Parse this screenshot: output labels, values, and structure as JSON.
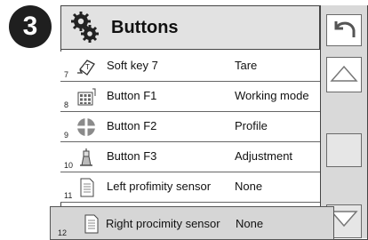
{
  "step_badge": "3",
  "header": {
    "title": "Buttons",
    "icon": "gears-icon"
  },
  "rows": [
    {
      "number": "7",
      "name": "Soft key 7",
      "value": "Tare",
      "icon": "tare-key-icon"
    },
    {
      "number": "8",
      "name": "Button F1",
      "value": "Working mode",
      "icon": "keypad-icon"
    },
    {
      "number": "9",
      "name": "Button F2",
      "value": "Profile",
      "icon": "crosshair-circle-icon"
    },
    {
      "number": "10",
      "name": "Button F3",
      "value": "Adjustment",
      "icon": "adjustment-icon"
    },
    {
      "number": "11",
      "name": "Left profimity sensor",
      "value": "None",
      "icon": "document-icon"
    }
  ],
  "selected_row": {
    "number": "12",
    "name": "Right procimity sensor",
    "value": "None",
    "icon": "document-icon"
  },
  "sidebar": {
    "back": "undo-arrow-icon",
    "up": "arrow-up-icon",
    "down": "arrow-down-icon"
  }
}
